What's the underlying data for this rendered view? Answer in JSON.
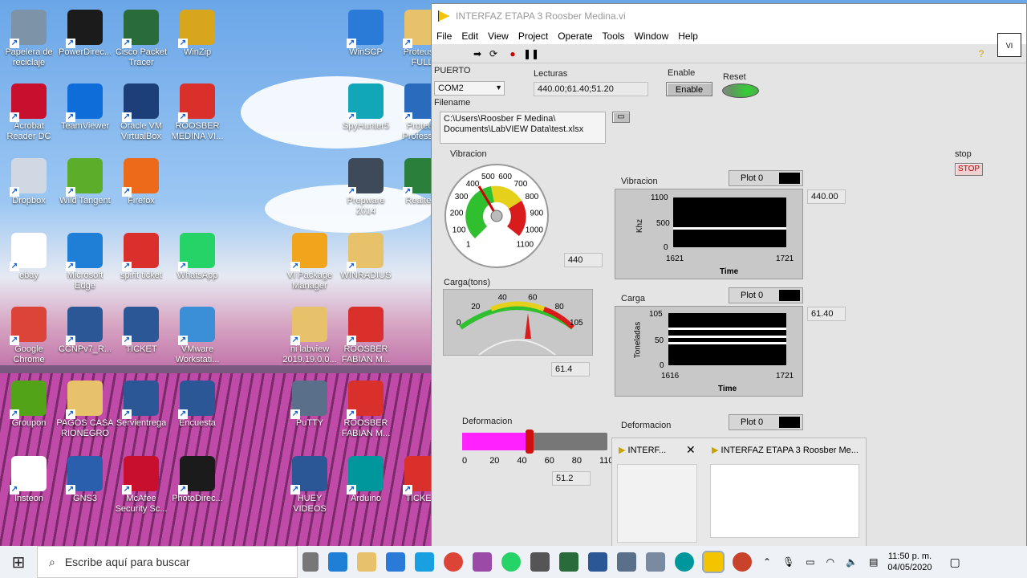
{
  "desktop_icons": [
    {
      "label": "Papelera de reciclaje",
      "icon": "recycle-bin-icon",
      "color": "#7d93a8"
    },
    {
      "label": "PowerDirec...",
      "icon": "powerdirector-icon",
      "color": "#1b1b1b"
    },
    {
      "label": "Cisco Packet Tracer",
      "icon": "cisco-icon",
      "color": "#2a6b3a"
    },
    {
      "label": "WinZip",
      "icon": "winzip-icon",
      "color": "#d8a61c"
    },
    {
      "label": "WinSCP",
      "icon": "winscp-icon",
      "color": "#2a7bd8"
    },
    {
      "label": "Proteus... FULL",
      "icon": "folder-icon",
      "color": "#e8c26a"
    },
    {
      "label": "Acrobat Reader DC",
      "icon": "acrobat-icon",
      "color": "#c8102e"
    },
    {
      "label": "TeamViewer",
      "icon": "teamviewer-icon",
      "color": "#0e6dd9"
    },
    {
      "label": "Oracle VM VirtualBox",
      "icon": "virtualbox-icon",
      "color": "#1c3f7a"
    },
    {
      "label": "ROOSBER MEDINA VI...",
      "icon": "pdf-icon",
      "color": "#d9302c"
    },
    {
      "label": "SpyHunter5",
      "icon": "spyhunter-icon",
      "color": "#12a7b8"
    },
    {
      "label": "Proteus Professi...",
      "icon": "proteus-icon",
      "color": "#2a6bbd"
    },
    {
      "label": "Dropbox",
      "icon": "dropbox-icon",
      "color": "#cfd8e3"
    },
    {
      "label": "Wild Tangent",
      "icon": "wildtangent-icon",
      "color": "#5cad2a"
    },
    {
      "label": "Firefox",
      "icon": "firefox-icon",
      "color": "#ec6a1a"
    },
    {
      "label": "Prepware 2014",
      "icon": "prepware-icon",
      "color": "#3e4a5a"
    },
    {
      "label": "Realte...",
      "icon": "realterm-icon",
      "color": "#2a7f3a"
    },
    {
      "label": "ebay",
      "icon": "ebay-icon",
      "color": "#ffffff"
    },
    {
      "label": "Microsoft Edge",
      "icon": "edge-icon",
      "color": "#1f7fd6"
    },
    {
      "label": "spirit ticket",
      "icon": "pdf-icon",
      "color": "#d9302c"
    },
    {
      "label": "WhatsApp",
      "icon": "whatsapp-icon",
      "color": "#25d366"
    },
    {
      "label": "VI Package Manager",
      "icon": "vipm-icon",
      "color": "#f0a51c"
    },
    {
      "label": "WINRADIUS",
      "icon": "folder-icon",
      "color": "#e8c26a"
    },
    {
      "label": "Google Chrome",
      "icon": "chrome-icon",
      "color": "#db4437"
    },
    {
      "label": "CCNPv7_R...",
      "icon": "word-icon",
      "color": "#2b5797"
    },
    {
      "label": "TICKET",
      "icon": "word-icon",
      "color": "#2b5797"
    },
    {
      "label": "VMware Workstati...",
      "icon": "vmware-icon",
      "color": "#3a8fd6"
    },
    {
      "label": "ni labview 2019.19.0.0...",
      "icon": "folder-icon",
      "color": "#e8c26a"
    },
    {
      "label": "ROOSBER FABIAN M...",
      "icon": "pdf-icon",
      "color": "#d9302c"
    },
    {
      "label": "Groupon",
      "icon": "groupon-icon",
      "color": "#53a318"
    },
    {
      "label": "PAGOS CASA RIONEGRO",
      "icon": "folder-icon",
      "color": "#e8c26a"
    },
    {
      "label": "Servientrega",
      "icon": "word-icon",
      "color": "#2b5797"
    },
    {
      "label": "Encuesta",
      "icon": "word-icon",
      "color": "#2b5797"
    },
    {
      "label": "PuTTY",
      "icon": "putty-icon",
      "color": "#5a6f8a"
    },
    {
      "label": "ROOSBER FABIAN M...",
      "icon": "pdf-icon",
      "color": "#d9302c"
    },
    {
      "label": "Insteon",
      "icon": "insteon-icon",
      "color": "#ffffff"
    },
    {
      "label": "GNS3",
      "icon": "gns3-icon",
      "color": "#2a5fae"
    },
    {
      "label": "McAfee Security Sc...",
      "icon": "mcafee-icon",
      "color": "#c8102e"
    },
    {
      "label": "PhotoDirec...",
      "icon": "photodirector-icon",
      "color": "#1b1b1b"
    },
    {
      "label": "HUEY VIDEOS",
      "icon": "word-icon",
      "color": "#2b5797"
    },
    {
      "label": "Arduino",
      "icon": "arduino-icon",
      "color": "#00979c"
    },
    {
      "label": "TICKE...",
      "icon": "pdf-icon",
      "color": "#d9302c"
    }
  ],
  "window": {
    "title": "INTERFAZ ETAPA 3 Roosber Medina.vi",
    "menu": [
      "File",
      "Edit",
      "View",
      "Project",
      "Operate",
      "Tools",
      "Window",
      "Help"
    ]
  },
  "panel": {
    "puerto_label": "PUERTO",
    "puerto_value": "COM2",
    "lecturas_label": "Lecturas",
    "lecturas_value": "440.00;61.40;51.20",
    "enable_label": "Enable",
    "enable_button": "Enable",
    "reset_label": "Reset",
    "filename_label": "Filename",
    "filename_value": "C:\\Users\\Roosber F Medina\\ Documents\\LabVIEW Data\\test.xlsx",
    "stop_label": "stop",
    "stop_button": "STOP",
    "vibracion_gauge_label": "Vibracion",
    "vibracion_gauge_value": "440",
    "vibracion_gauge_ticks": [
      "1",
      "100",
      "200",
      "300",
      "400",
      "500",
      "600",
      "700",
      "800",
      "900",
      "1000",
      "1100"
    ],
    "carga_meter_label": "Carga(tons)",
    "carga_meter_value": "61.4",
    "carga_meter_ticks": [
      "0",
      "20",
      "40",
      "60",
      "80",
      "105"
    ],
    "deformacion_label": "Deformacion",
    "deformacion_value": "51.2",
    "deformacion_fraction": 0.465,
    "deformacion_ticks": [
      "0",
      "20",
      "40",
      "60",
      "80",
      "110"
    ],
    "graph_vibracion": {
      "title": "Vibracion",
      "legend": "Plot 0",
      "ylabel": "Khz",
      "xlabel": "Time",
      "y_ticks": [
        "1100",
        "500",
        "0"
      ],
      "x_min": "1621",
      "x_max": "1721",
      "value": "440.00"
    },
    "graph_carga": {
      "title": "Carga",
      "legend": "Plot 0",
      "ylabel": "Toneladas",
      "xlabel": "Time",
      "y_ticks": [
        "105",
        "50",
        "0"
      ],
      "x_min": "1616",
      "x_max": "1721",
      "value": "61.40"
    },
    "graph_deformacion": {
      "title": "Deformacion",
      "legend": "Plot 0"
    }
  },
  "preview": {
    "tab1": "INTERF...",
    "tab2": "INTERFAZ ETAPA 3 Roosber Me..."
  },
  "taskbar": {
    "search_placeholder": "Escribe aquí para buscar",
    "time": "11:50 p. m.",
    "date": "04/05/2020"
  }
}
